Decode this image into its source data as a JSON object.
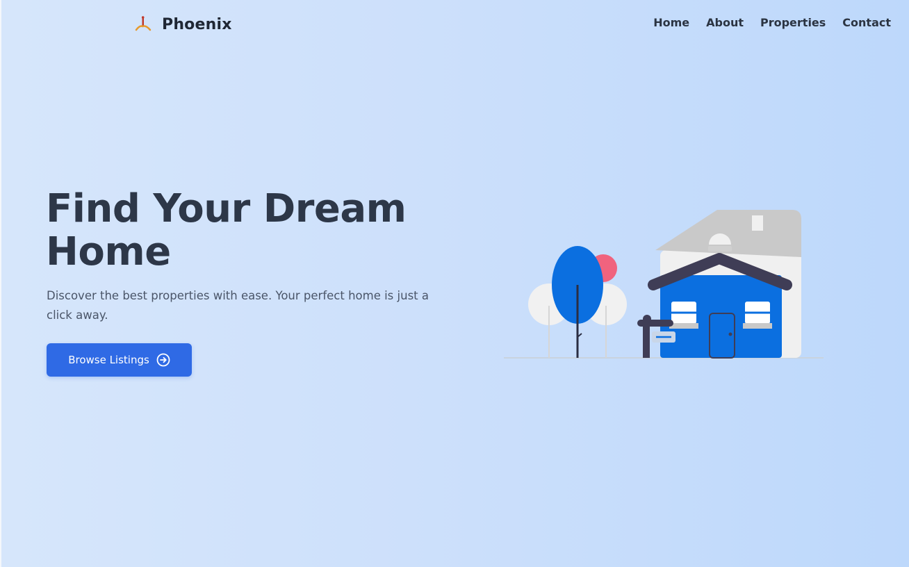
{
  "header": {
    "brand_name": "Phoenix",
    "brand_icon": "phoenix-logo-icon",
    "nav": [
      {
        "label": "Home"
      },
      {
        "label": "About"
      },
      {
        "label": "Properties"
      },
      {
        "label": "Contact"
      }
    ]
  },
  "hero": {
    "title_line1": "Find Your Dream",
    "title_line2": "Home",
    "description": "Discover the best properties with ease. Your perfect home is just a click away.",
    "cta_label": "Browse Listings",
    "cta_icon": "arrow-right-circle-icon",
    "illustration": "house-illustration"
  },
  "colors": {
    "accent": "#2f6ae5",
    "house_blue": "#0b6fe0",
    "heading": "#2d3748",
    "background_start": "#d6e6fb",
    "background_end": "#bdd8fb"
  }
}
